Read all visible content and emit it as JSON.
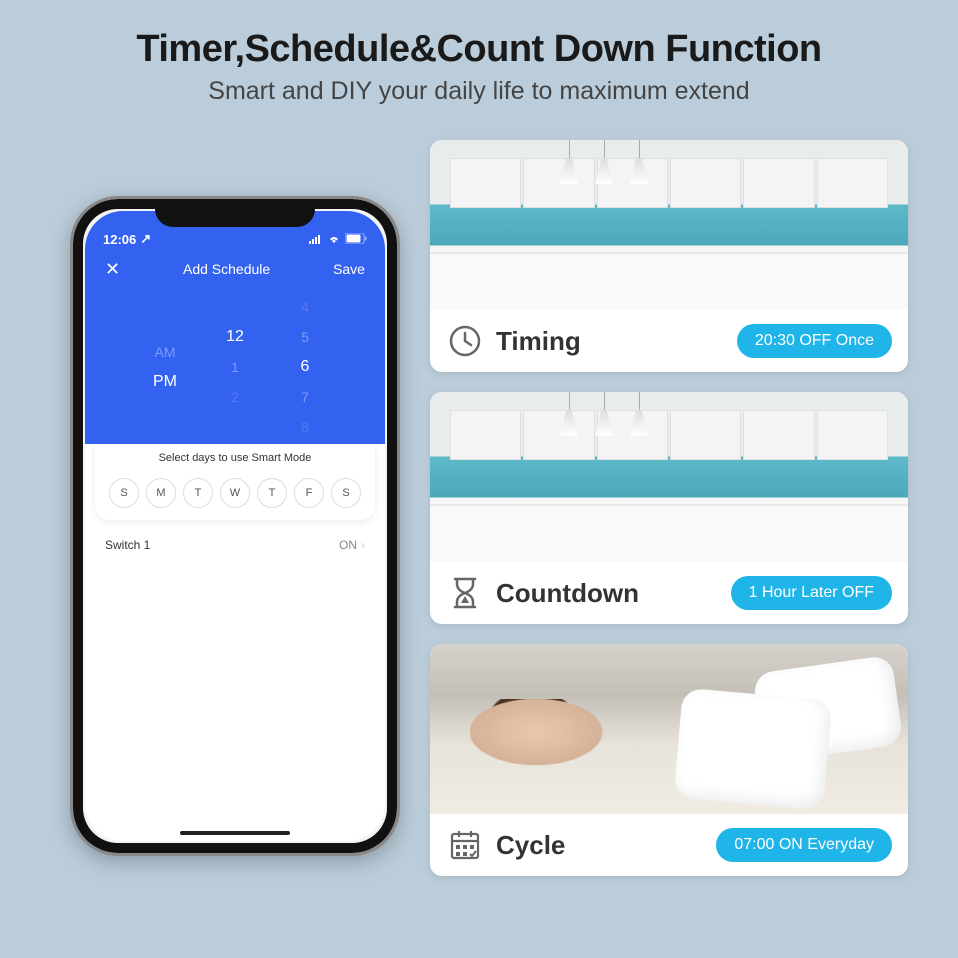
{
  "header": {
    "title": "Timer,Schedule&Count Down Function",
    "subtitle": "Smart and DIY your daily life to maximum extend"
  },
  "phone": {
    "status": {
      "time": "12:06",
      "loc_icon": "↗"
    },
    "nav": {
      "close": "✕",
      "title": "Add Schedule",
      "save": "Save"
    },
    "picker": {
      "ampm": [
        "AM",
        "PM",
        ""
      ],
      "hour": [
        "",
        "12",
        "1",
        "2"
      ],
      "minute": [
        "4",
        "5",
        "6",
        "7",
        "8"
      ]
    },
    "card": {
      "title": "Select days to use Smart Mode",
      "days": [
        "S",
        "M",
        "T",
        "W",
        "T",
        "F",
        "S"
      ]
    },
    "switch": {
      "name": "Switch 1",
      "value": "ON"
    }
  },
  "tiles": [
    {
      "icon": "clock",
      "label": "Timing",
      "pill": "20:30 OFF Once",
      "scene": "kitchen"
    },
    {
      "icon": "hourglass",
      "label": "Countdown",
      "pill": "1 Hour Later OFF",
      "scene": "kitchen"
    },
    {
      "icon": "calendar",
      "label": "Cycle",
      "pill": "07:00 ON Everyday",
      "scene": "bedroom"
    }
  ]
}
